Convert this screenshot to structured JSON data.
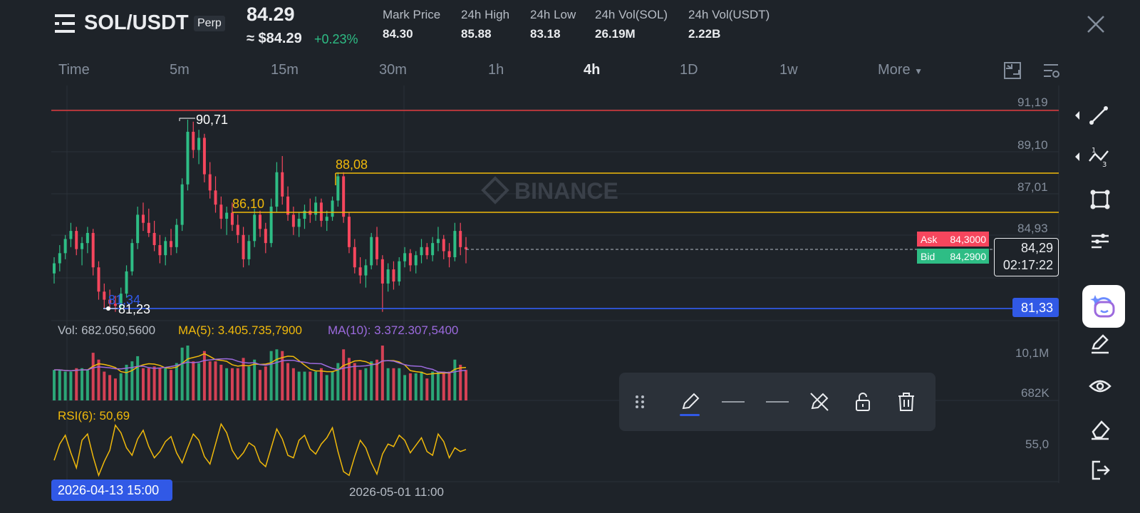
{
  "header": {
    "pair": "SOL/USDT",
    "contract_type": "Perp",
    "last_price": "84.29",
    "usd_price": "≈ $84.29",
    "change": "+0.23%",
    "stats": [
      {
        "label": "Mark Price",
        "value": "84.30"
      },
      {
        "label": "24h High",
        "value": "85.88"
      },
      {
        "label": "24h Low",
        "value": "83.18"
      },
      {
        "label": "24h Vol(SOL)",
        "value": "26.19M"
      },
      {
        "label": "24h Vol(USDT)",
        "value": "2.22B"
      }
    ]
  },
  "tabs": [
    "Time",
    "5m",
    "15m",
    "30m",
    "1h",
    "4h",
    "1D",
    "1w",
    "More"
  ],
  "active_tab": "4h",
  "watermark": "BINANCE",
  "price_axis": [
    "91,19",
    "89,10",
    "87,01",
    "84,93",
    "81,33"
  ],
  "drawn_lines": {
    "red": "91,19",
    "yellow_upper": "88,08",
    "yellow_lower": "86,10",
    "blue": "81,34",
    "blue_tag": "81,33"
  },
  "annotations": {
    "high_marker": "90,71",
    "low_marker": "81,23"
  },
  "orderbook": {
    "ask_label": "Ask",
    "ask_value": "84,3000",
    "bid_label": "Bid",
    "bid_value": "84,2900",
    "current_price": "84,29",
    "countdown": "02:17:22"
  },
  "volume": {
    "vol_label": "Vol: 682.050,5600",
    "ma5_label": "MA(5): 3.405.735,7900",
    "ma10_label": "MA(10): 3.372.307,5400",
    "axis_top": "10,1M",
    "axis_bottom": "682K"
  },
  "rsi": {
    "label": "RSI(6): 50,69",
    "axis": "55,0"
  },
  "time_axis": {
    "selected_date": "2026-04-13 15:00",
    "mid_date": "2026-05-01 11:00"
  },
  "colors": {
    "background": "#1e2329",
    "up": "#2ebd85",
    "down": "#f6465d",
    "yellow": "#f0b90b",
    "blue": "#3159e6",
    "ma5": "#f0b90b",
    "ma10": "#9c6ade",
    "red_line": "#e03a3e"
  },
  "chart_data": {
    "type": "candlestick",
    "y_range": [
      80.5,
      92.0
    ],
    "ohlc": [
      [
        83.1,
        83.9,
        82.6,
        83.6
      ],
      [
        83.6,
        84.5,
        83.2,
        84.1
      ],
      [
        84.1,
        85.0,
        83.8,
        84.8
      ],
      [
        84.8,
        85.6,
        84.4,
        85.2
      ],
      [
        85.2,
        85.4,
        84.0,
        84.3
      ],
      [
        84.3,
        84.9,
        83.5,
        84.6
      ],
      [
        84.6,
        85.4,
        84.1,
        85.1
      ],
      [
        85.1,
        85.3,
        83.0,
        83.4
      ],
      [
        83.4,
        83.7,
        81.8,
        82.2
      ],
      [
        82.2,
        82.6,
        81.4,
        81.8
      ],
      [
        81.8,
        82.3,
        81.3,
        81.6
      ],
      [
        81.6,
        82.0,
        81.2,
        81.5
      ],
      [
        81.5,
        82.4,
        81.3,
        82.1
      ],
      [
        82.1,
        83.5,
        81.9,
        83.2
      ],
      [
        83.2,
        84.8,
        83.0,
        84.6
      ],
      [
        84.6,
        86.4,
        84.3,
        86.0
      ],
      [
        86.0,
        86.6,
        85.2,
        85.6
      ],
      [
        85.6,
        86.3,
        84.9,
        85.1
      ],
      [
        85.1,
        85.7,
        84.2,
        84.5
      ],
      [
        84.5,
        85.0,
        83.6,
        84.0
      ],
      [
        84.0,
        84.9,
        83.5,
        84.7
      ],
      [
        84.7,
        85.3,
        84.0,
        84.4
      ],
      [
        84.4,
        85.8,
        84.1,
        85.5
      ],
      [
        85.5,
        87.8,
        85.2,
        87.5
      ],
      [
        87.5,
        90.7,
        87.2,
        90.1
      ],
      [
        90.1,
        90.6,
        88.8,
        89.2
      ],
      [
        89.2,
        90.2,
        88.5,
        89.8
      ],
      [
        89.8,
        90.0,
        87.6,
        88.0
      ],
      [
        88.0,
        88.6,
        86.8,
        87.2
      ],
      [
        87.2,
        87.9,
        86.1,
        86.5
      ],
      [
        86.5,
        86.9,
        85.3,
        85.8
      ],
      [
        85.8,
        86.4,
        85.0,
        86.1
      ],
      [
        86.1,
        86.6,
        85.2,
        85.5
      ],
      [
        85.5,
        86.0,
        84.6,
        85.0
      ],
      [
        85.0,
        85.4,
        83.4,
        83.8
      ],
      [
        83.8,
        85.0,
        83.5,
        84.7
      ],
      [
        84.7,
        86.3,
        84.4,
        86.0
      ],
      [
        86.0,
        86.2,
        84.9,
        85.3
      ],
      [
        85.3,
        85.6,
        84.1,
        84.6
      ],
      [
        84.6,
        86.8,
        84.4,
        86.4
      ],
      [
        86.4,
        88.6,
        86.1,
        88.1
      ],
      [
        88.1,
        88.9,
        86.5,
        86.9
      ],
      [
        86.9,
        87.4,
        85.7,
        86.0
      ],
      [
        86.0,
        86.4,
        85.0,
        85.4
      ],
      [
        85.4,
        86.1,
        84.9,
        85.8
      ],
      [
        85.8,
        86.5,
        85.3,
        86.2
      ],
      [
        86.2,
        86.8,
        85.6,
        86.0
      ],
      [
        86.0,
        86.9,
        85.7,
        86.6
      ],
      [
        86.6,
        86.8,
        85.4,
        85.7
      ],
      [
        85.7,
        86.2,
        85.2,
        85.9
      ],
      [
        85.9,
        86.9,
        85.7,
        86.7
      ],
      [
        86.7,
        88.1,
        86.4,
        87.9
      ],
      [
        87.9,
        88.1,
        85.6,
        85.9
      ],
      [
        85.9,
        86.1,
        84.1,
        84.4
      ],
      [
        84.4,
        84.8,
        83.1,
        83.4
      ],
      [
        83.4,
        83.9,
        82.6,
        83.0
      ],
      [
        83.0,
        83.8,
        82.4,
        83.5
      ],
      [
        83.5,
        85.1,
        83.3,
        84.9
      ],
      [
        84.9,
        85.4,
        83.5,
        83.8
      ],
      [
        83.8,
        84.0,
        81.2,
        82.6
      ],
      [
        82.6,
        83.6,
        82.2,
        83.3
      ],
      [
        83.3,
        83.7,
        82.3,
        82.7
      ],
      [
        82.7,
        83.9,
        82.5,
        83.7
      ],
      [
        83.7,
        84.4,
        83.4,
        84.1
      ],
      [
        84.1,
        84.3,
        83.2,
        83.5
      ],
      [
        83.5,
        84.2,
        83.1,
        84.0
      ],
      [
        84.0,
        84.8,
        83.6,
        84.4
      ],
      [
        84.4,
        84.6,
        83.8,
        84.0
      ],
      [
        84.0,
        84.9,
        83.7,
        84.6
      ],
      [
        84.6,
        85.4,
        84.2,
        84.8
      ],
      [
        84.8,
        85.0,
        83.8,
        84.2
      ],
      [
        84.2,
        84.6,
        83.4,
        83.9
      ],
      [
        83.9,
        85.6,
        83.7,
        85.2
      ],
      [
        85.2,
        85.6,
        84.0,
        84.4
      ],
      [
        84.4,
        84.9,
        83.6,
        84.29
      ]
    ],
    "rsi": [
      42,
      55,
      62,
      48,
      36,
      58,
      63,
      45,
      30,
      41,
      50,
      70,
      64,
      52,
      46,
      59,
      66,
      53,
      44,
      49,
      57,
      61,
      48,
      40,
      52,
      63,
      58,
      45,
      39,
      55,
      71,
      64,
      50,
      43,
      48,
      56,
      53,
      41,
      37,
      52,
      67,
      59,
      46,
      44,
      58,
      62,
      51,
      47,
      55,
      60,
      68,
      49,
      33,
      30,
      45,
      58,
      52,
      40,
      31,
      47,
      55,
      53,
      62,
      58,
      48,
      54,
      60,
      49,
      46,
      63,
      57,
      44,
      52,
      49,
      50.69
    ],
    "volume_axis": [
      "10,1M",
      "682K"
    ],
    "rsi_axis": [
      "55,0"
    ]
  }
}
